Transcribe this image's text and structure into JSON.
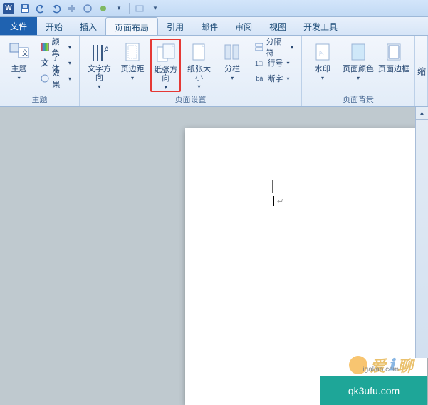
{
  "tabs": {
    "file": "文件",
    "items": [
      "开始",
      "插入",
      "页面布局",
      "引用",
      "邮件",
      "审阅",
      "视图",
      "开发工具"
    ],
    "active_index": 2
  },
  "ribbon": {
    "theme": {
      "label": "主题",
      "theme_btn": "主题",
      "colors": "颜色",
      "fonts": "字体",
      "effects": "效果"
    },
    "page_setup": {
      "label": "页面设置",
      "text_direction": "文字方向",
      "margins": "页边距",
      "orientation": "纸张方向",
      "size": "纸张大小",
      "columns": "分栏",
      "breaks": "分隔符",
      "line_numbers": "行号",
      "hyphenation": "断字"
    },
    "page_bg": {
      "label": "页面背景",
      "watermark": "水印",
      "page_color": "页面颜色",
      "page_borders": "页面边框"
    },
    "truncated": "缩"
  },
  "watermark": {
    "text1": "爱",
    "text2": "聊",
    "url": "igaliao.com"
  },
  "strip": {
    "url": "qk3ufu.com"
  },
  "colors": {
    "file_tab": "#1f62b0",
    "highlight": "#e53935",
    "strip": "#1ea698"
  }
}
